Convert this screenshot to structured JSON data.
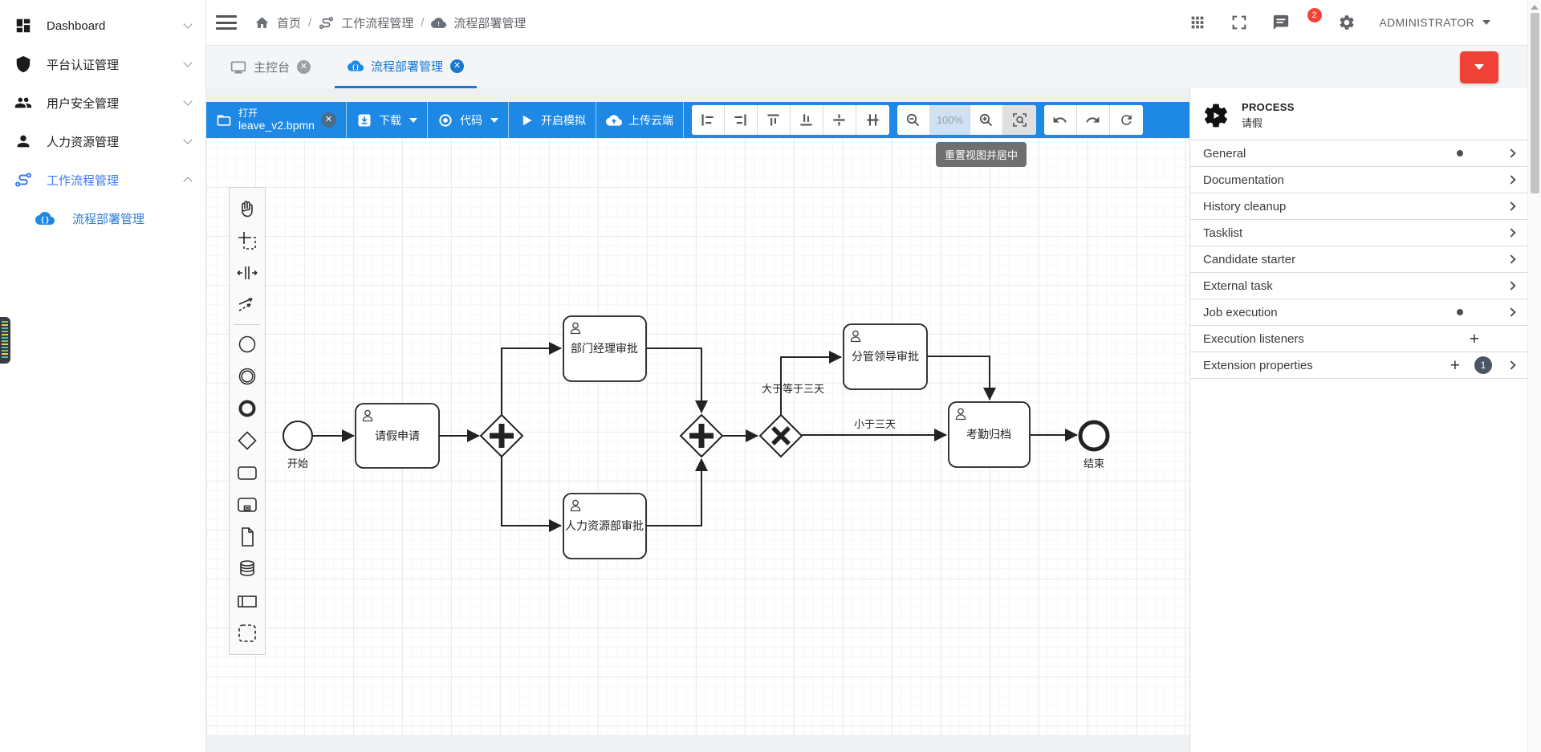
{
  "sidebar": {
    "items": [
      {
        "label": "Dashboard"
      },
      {
        "label": "平台认证管理"
      },
      {
        "label": "用户安全管理"
      },
      {
        "label": "人力资源管理"
      },
      {
        "label": "工作流程管理"
      }
    ],
    "submenu_label": "流程部署管理"
  },
  "header": {
    "breadcrumb": [
      "首页",
      "工作流程管理",
      "流程部署管理"
    ],
    "user": "ADMINISTRATOR",
    "notification_badge": "2"
  },
  "tabs": [
    {
      "label": "主控台"
    },
    {
      "label": "流程部署管理"
    }
  ],
  "toolbar": {
    "open_label": "打开",
    "open_file": "leave_v2.bpmn",
    "download_label": "下载",
    "code_label": "代码",
    "simulate_label": "开启模拟",
    "upload_label": "上传云端",
    "zoom_level": "100%"
  },
  "tooltip": {
    "text": "重置视图并居中"
  },
  "diagram": {
    "start_label": "开始",
    "end_label": "结束",
    "tasks": [
      {
        "label": "请假申请"
      },
      {
        "label": "部门经理审批"
      },
      {
        "label": "人力资源部审批"
      },
      {
        "label": "分管领导审批"
      },
      {
        "label": "考勤归档"
      }
    ],
    "edge_labels": [
      "大于等于三天",
      "小于三天"
    ]
  },
  "panel": {
    "type_label": "PROCESS",
    "name": "请假",
    "sections": [
      {
        "label": "General"
      },
      {
        "label": "Documentation"
      },
      {
        "label": "History cleanup"
      },
      {
        "label": "Tasklist"
      },
      {
        "label": "Candidate starter"
      },
      {
        "label": "External task"
      },
      {
        "label": "Job execution"
      },
      {
        "label": "Execution listeners"
      },
      {
        "label": "Extension properties",
        "badge": "1"
      }
    ]
  },
  "colors": {
    "toolbar_blue": "#1e88e5",
    "tab_active_blue": "#1778d2",
    "sidebar_active_blue": "#3d7cf4",
    "red_button": "#ef4136",
    "badge_red": "#f44336",
    "diagram_stroke": "#222222"
  }
}
